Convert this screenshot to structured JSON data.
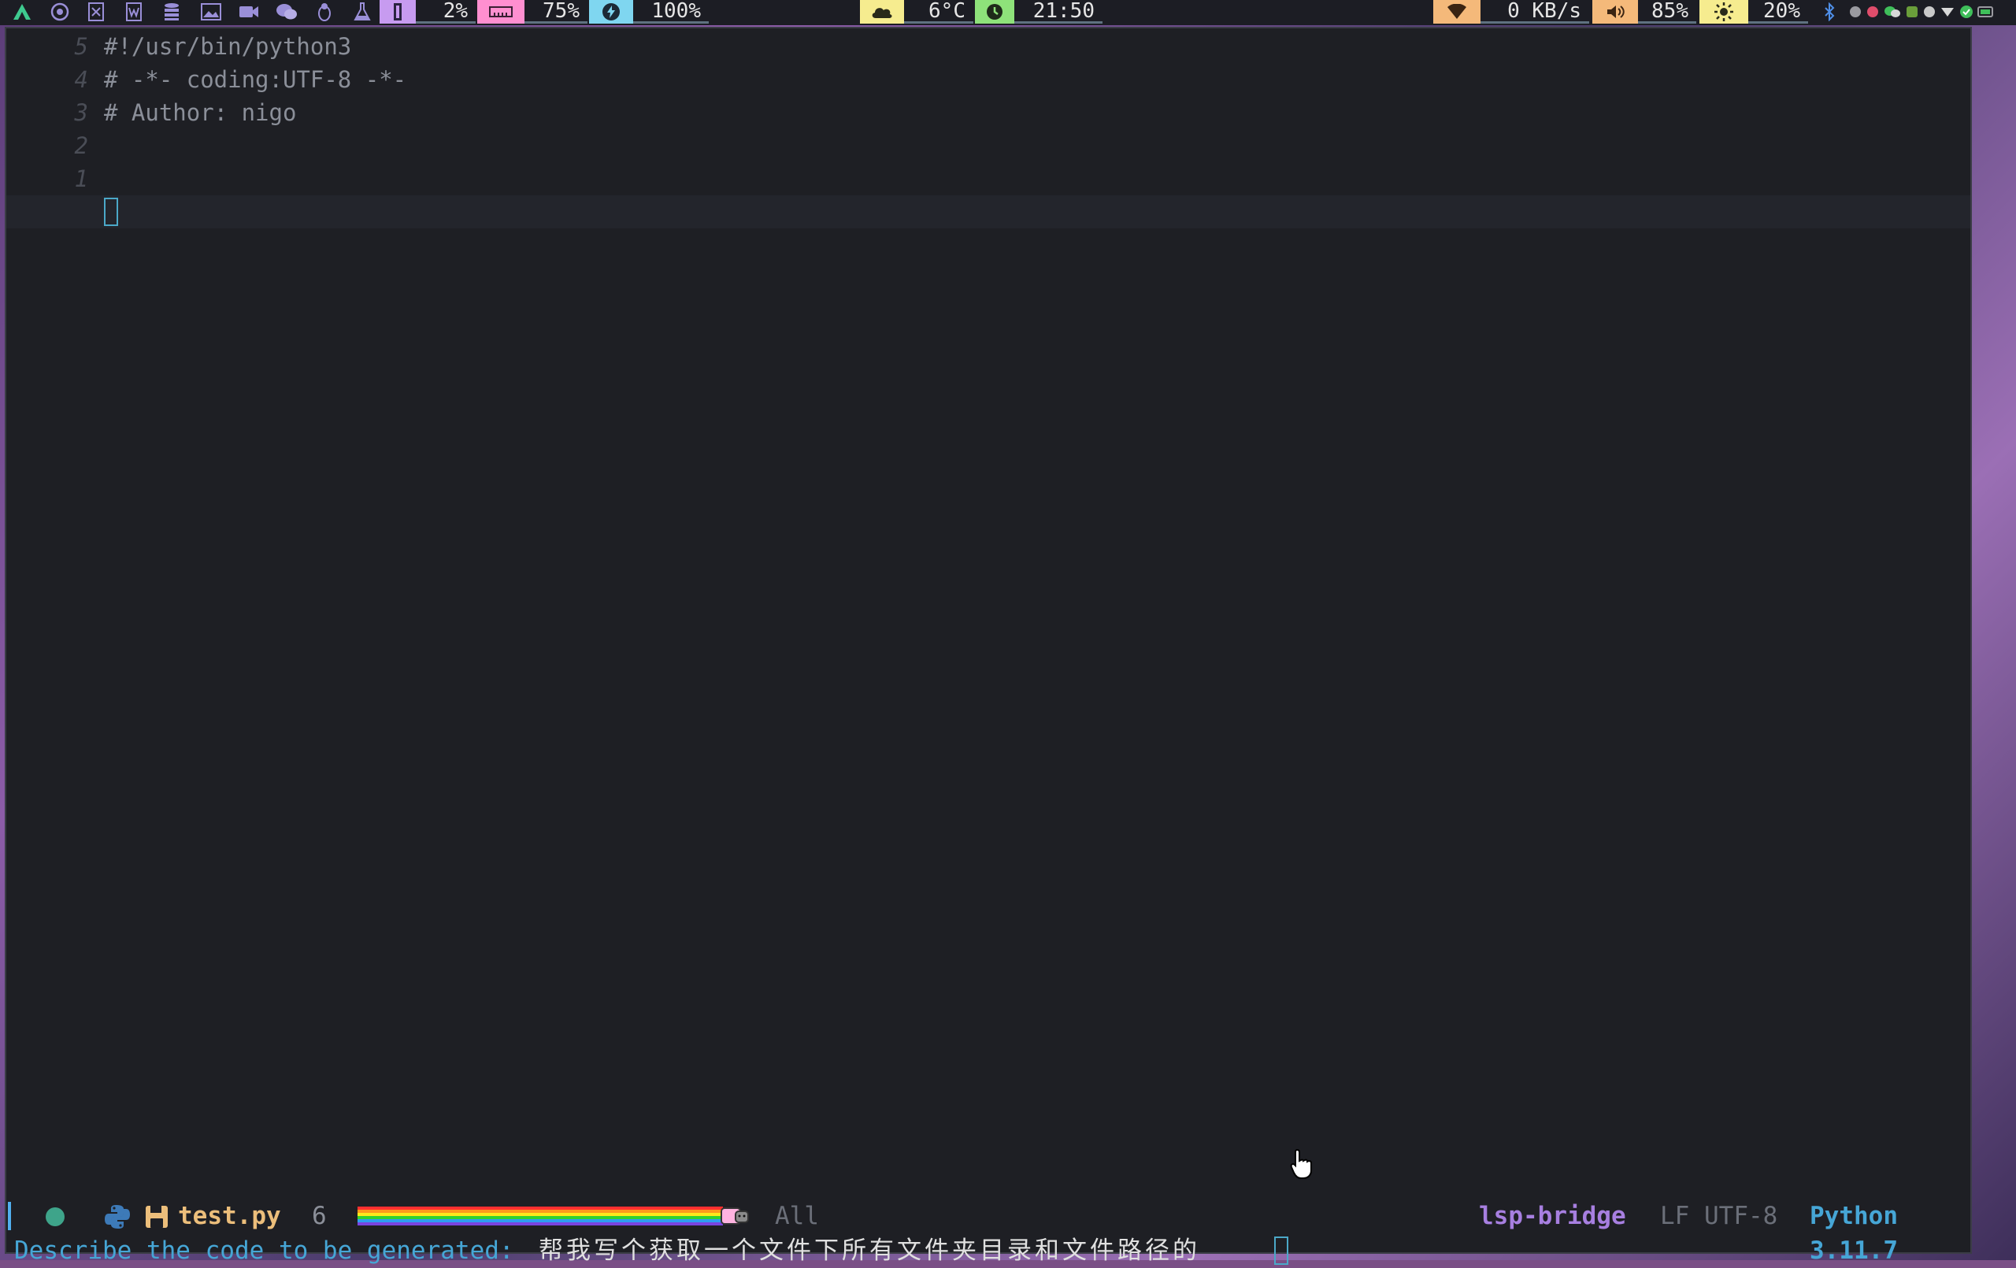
{
  "statusbar": {
    "cpu": "2%",
    "memory": "75%",
    "battery": "100%",
    "weather": "6°C",
    "clock": "21:50",
    "net_speed": "0 KB/s",
    "volume": "85%",
    "brightness": "20%"
  },
  "editor": {
    "lines": [
      {
        "num": "5",
        "text": "#!/usr/bin/python3"
      },
      {
        "num": "4",
        "text": "# -*- coding:UTF-8 -*-"
      },
      {
        "num": "3",
        "text": "# Author: nigo"
      },
      {
        "num": "2",
        "text": ""
      },
      {
        "num": "1",
        "text": ""
      },
      {
        "num": "",
        "text": ""
      }
    ]
  },
  "modeline": {
    "filename": "test.py",
    "line_count": "6",
    "position": "All",
    "lsp": "lsp-bridge",
    "encoding": "LF UTF-8",
    "language": "Python 3.11.7"
  },
  "minibuffer": {
    "prompt": "Describe the code to be generated:",
    "input": "帮我写个获取一个文件下所有文件夹目录和文件路径的"
  },
  "colors": {
    "background": "#1e1f24",
    "accent_blue": "#46a6d6",
    "accent_purple": "#a77fe0",
    "filename_yellow": "#ecbe7b"
  }
}
